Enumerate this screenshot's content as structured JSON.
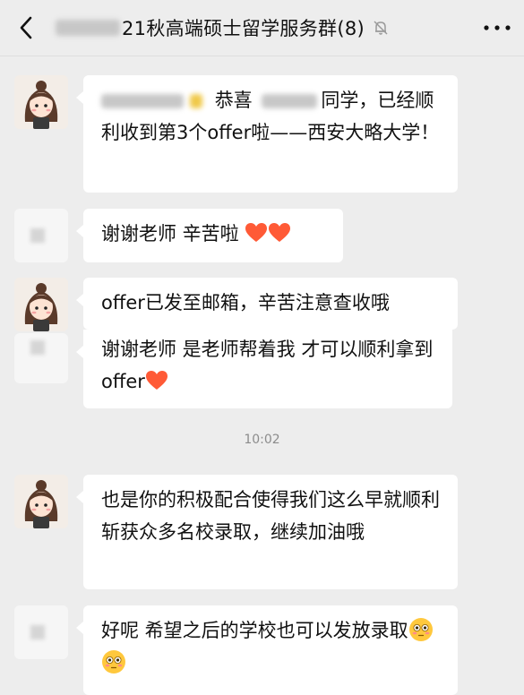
{
  "header": {
    "title": "21秋高端硕士留学服务群(8)",
    "back_icon": "chevron-left-icon",
    "mute_icon": "bell-off-icon",
    "more_icon": "more-dots-icon"
  },
  "messages": [
    {
      "sender": "teacher",
      "part1": "恭喜",
      "part2": "同学，已经顺利收到第3个offer啦——西安大略大学！"
    },
    {
      "sender": "student",
      "text": "谢谢老师 辛苦啦"
    },
    {
      "sender": "teacher",
      "text": "offer已发至邮箱，辛苦注意查收哦"
    },
    {
      "sender": "student",
      "text": "谢谢老师 是老师帮着我 才可以顺利拿到offer"
    },
    {
      "sender": "teacher",
      "text": "也是你的积极配合使得我们这么早就顺利斩获众多名校录取，继续加油哦"
    },
    {
      "sender": "student",
      "text": "好呢 希望之后的学校也可以发放录取"
    }
  ],
  "timestamp": "10:02",
  "colors": {
    "background": "#ededed",
    "bubble": "#ffffff",
    "heart": "#ff5a36",
    "emoji": "#ffc83d"
  }
}
